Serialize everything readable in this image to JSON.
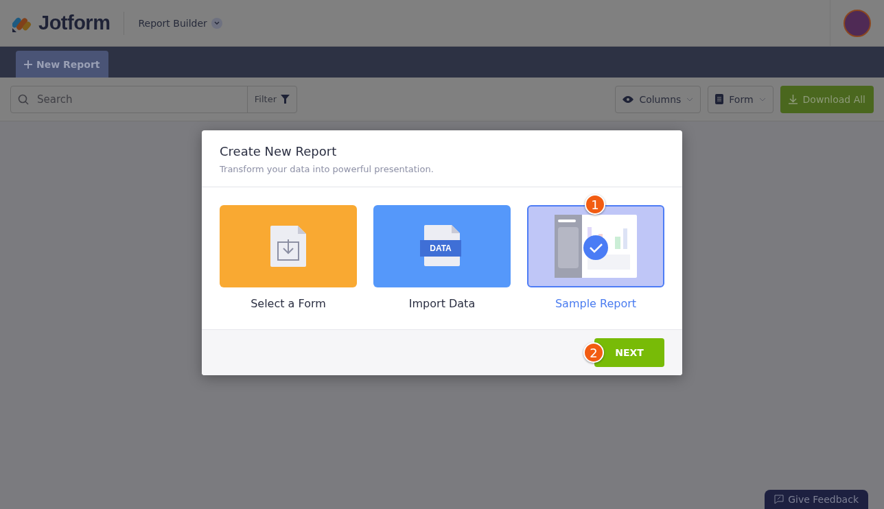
{
  "header": {
    "logo": "Jotform",
    "app_title": "Report Builder"
  },
  "tabs": [
    {
      "label": "New Report",
      "selected": true
    }
  ],
  "toolbar": {
    "search": {
      "placeholder": "Search"
    },
    "filter": "Filter",
    "columns": "Columns",
    "form": "Form",
    "download": "Download All"
  },
  "modal": {
    "title": "Create New Report",
    "subtitle": "Transform your data into powerful presentation.",
    "options": [
      {
        "kind": "form",
        "label": "Select a Form",
        "selected": false
      },
      {
        "kind": "data",
        "label": "Import Data",
        "icon_text": "DATA",
        "selected": false
      },
      {
        "kind": "sample",
        "label": "Sample Report",
        "selected": true,
        "step": "1"
      }
    ],
    "next": {
      "label": "NEXT",
      "step": "2"
    }
  },
  "feedback": "Give Feedback"
}
